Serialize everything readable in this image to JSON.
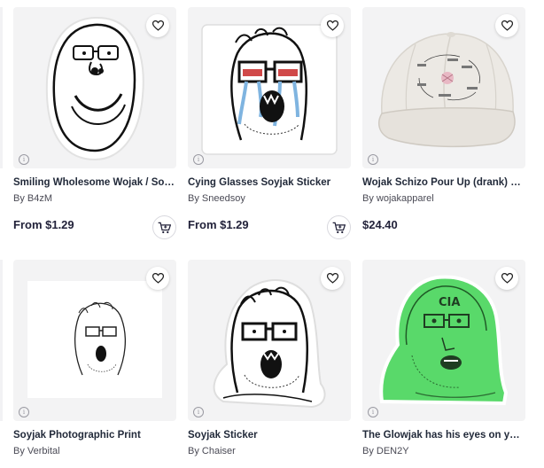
{
  "products": [
    {
      "title": "Smiling Wholesome Wojak / Soyjak Sticker",
      "artist": "By B4zM",
      "price": "From $1.29",
      "has_cart": true
    },
    {
      "title": "Cying Glasses Soyjak Sticker",
      "artist": "By Sneedsoy",
      "price": "From $1.29",
      "has_cart": true
    },
    {
      "title": "Wojak Schizo Pour Up (drank) Dad Hat",
      "artist": "By wojakapparel",
      "price": "$24.40",
      "has_cart": false
    },
    {
      "title": "Soyjak Photographic Print",
      "artist": "By Verbital",
      "price": "",
      "has_cart": false
    },
    {
      "title": "Soyjak Sticker",
      "artist": "By Chaiser",
      "price": "",
      "has_cart": false
    },
    {
      "title": "The Glowjak has his eyes on you Sticker",
      "artist": "By DEN2Y",
      "price": "",
      "has_cart": false
    }
  ],
  "icons": {
    "favorite": "heart-outline-icon",
    "info": "info-circle-icon",
    "cart": "add-to-cart-icon"
  },
  "artwork_text": {
    "glowjak_cap": "CIA"
  },
  "colors": {
    "card_background": "#f3f3f4",
    "glowjak_green": "#59d96a",
    "tears_blue": "#7fb4e0"
  }
}
